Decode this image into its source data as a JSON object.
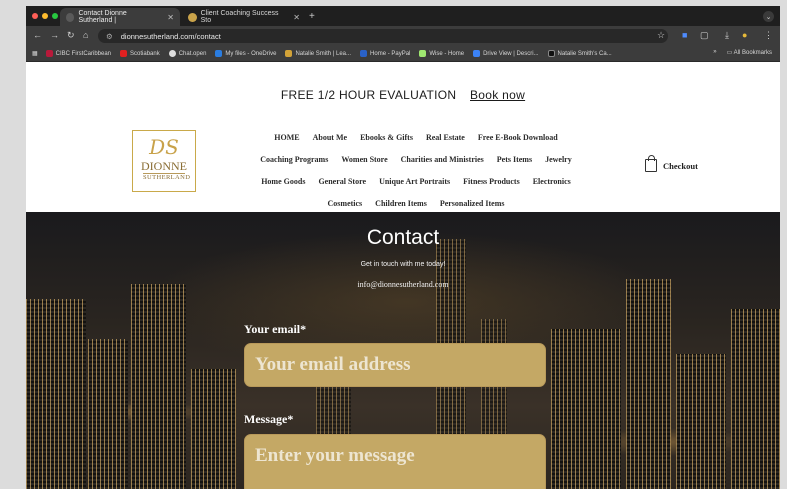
{
  "browser": {
    "tabs": [
      {
        "title": "Contact Dionne Sutherland |",
        "active": true
      },
      {
        "title": "Client Coaching Success Sto",
        "active": false
      }
    ],
    "url": "dionnesutherland.com/contact",
    "bookmarks": [
      "CIBC FirstCaribbean",
      "Scotiabank",
      "Chat.open",
      "My files - OneDrive",
      "Natalie Smith | Lea...",
      "Home - PayPal",
      "Wise - Home",
      "Drive View | Descri...",
      "Natalie Smith's Ca..."
    ],
    "all_bookmarks": "All Bookmarks",
    "overflow": "»"
  },
  "site": {
    "promo_text": "FREE 1/2 HOUR EVALUATION",
    "promo_link": "Book now",
    "logo": {
      "monogram": "DS",
      "line1": "DIONNE",
      "line2": "SUTHERLAND"
    },
    "menu_rows": [
      [
        "HOME",
        "About Me",
        "Ebooks & Gifts",
        "Real Estate",
        "Free E-Book Download"
      ],
      [
        "Coaching Programs",
        "Women Store",
        "Charities and Ministries",
        "Pets Items",
        "Jewelry"
      ],
      [
        "Home Goods",
        "General Store",
        "Unique Art Portraits",
        "Fitness Products",
        "Electronics"
      ],
      [
        "Cosmetics",
        "Children Items",
        "Personalized Items"
      ]
    ],
    "checkout": "Checkout"
  },
  "contact": {
    "title": "Contact",
    "subtitle": "Get in touch with me today!",
    "email": "info@dionnesutherland.com",
    "email_label": "Your email*",
    "email_placeholder": "Your email address",
    "message_label": "Message*",
    "message_placeholder": "Enter your message"
  },
  "colors": {
    "gold": "#c4a865",
    "header_bg": "#ffffff",
    "browser_bg": "#3c3c3c"
  }
}
